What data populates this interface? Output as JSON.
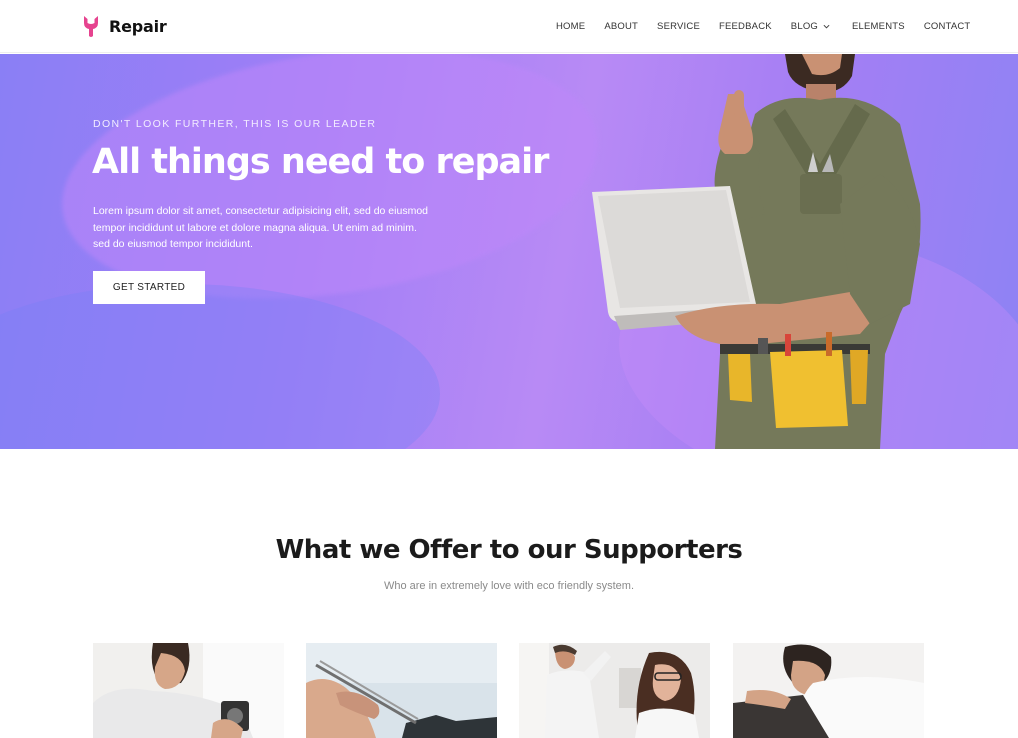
{
  "brand": {
    "name": "Repair",
    "accent": "#e6438f"
  },
  "nav": {
    "items": [
      {
        "label": "HOME"
      },
      {
        "label": "ABOUT"
      },
      {
        "label": "SERVICE"
      },
      {
        "label": "FEEDBACK"
      },
      {
        "label": "BLOG",
        "has_dropdown": true
      },
      {
        "label": "ELEMENTS"
      },
      {
        "label": "CONTACT"
      }
    ]
  },
  "hero": {
    "tagline": "DON'T LOOK FURTHER, THIS IS OUR LEADER",
    "title": "All things need to repair",
    "description": "Lorem ipsum dolor sit amet, consectetur adipisicing elit, sed do eiusmod tempor incididunt ut labore et dolore magna aliqua. Ut enim ad minim. sed do eiusmod tempor incididunt.",
    "cta_label": "GET STARTED",
    "gradient": [
      "#8a7ff5",
      "#b88af5"
    ]
  },
  "offer": {
    "title": "What we Offer to our Supporters",
    "subtitle": "Who are in extremely love with eco friendly system."
  }
}
